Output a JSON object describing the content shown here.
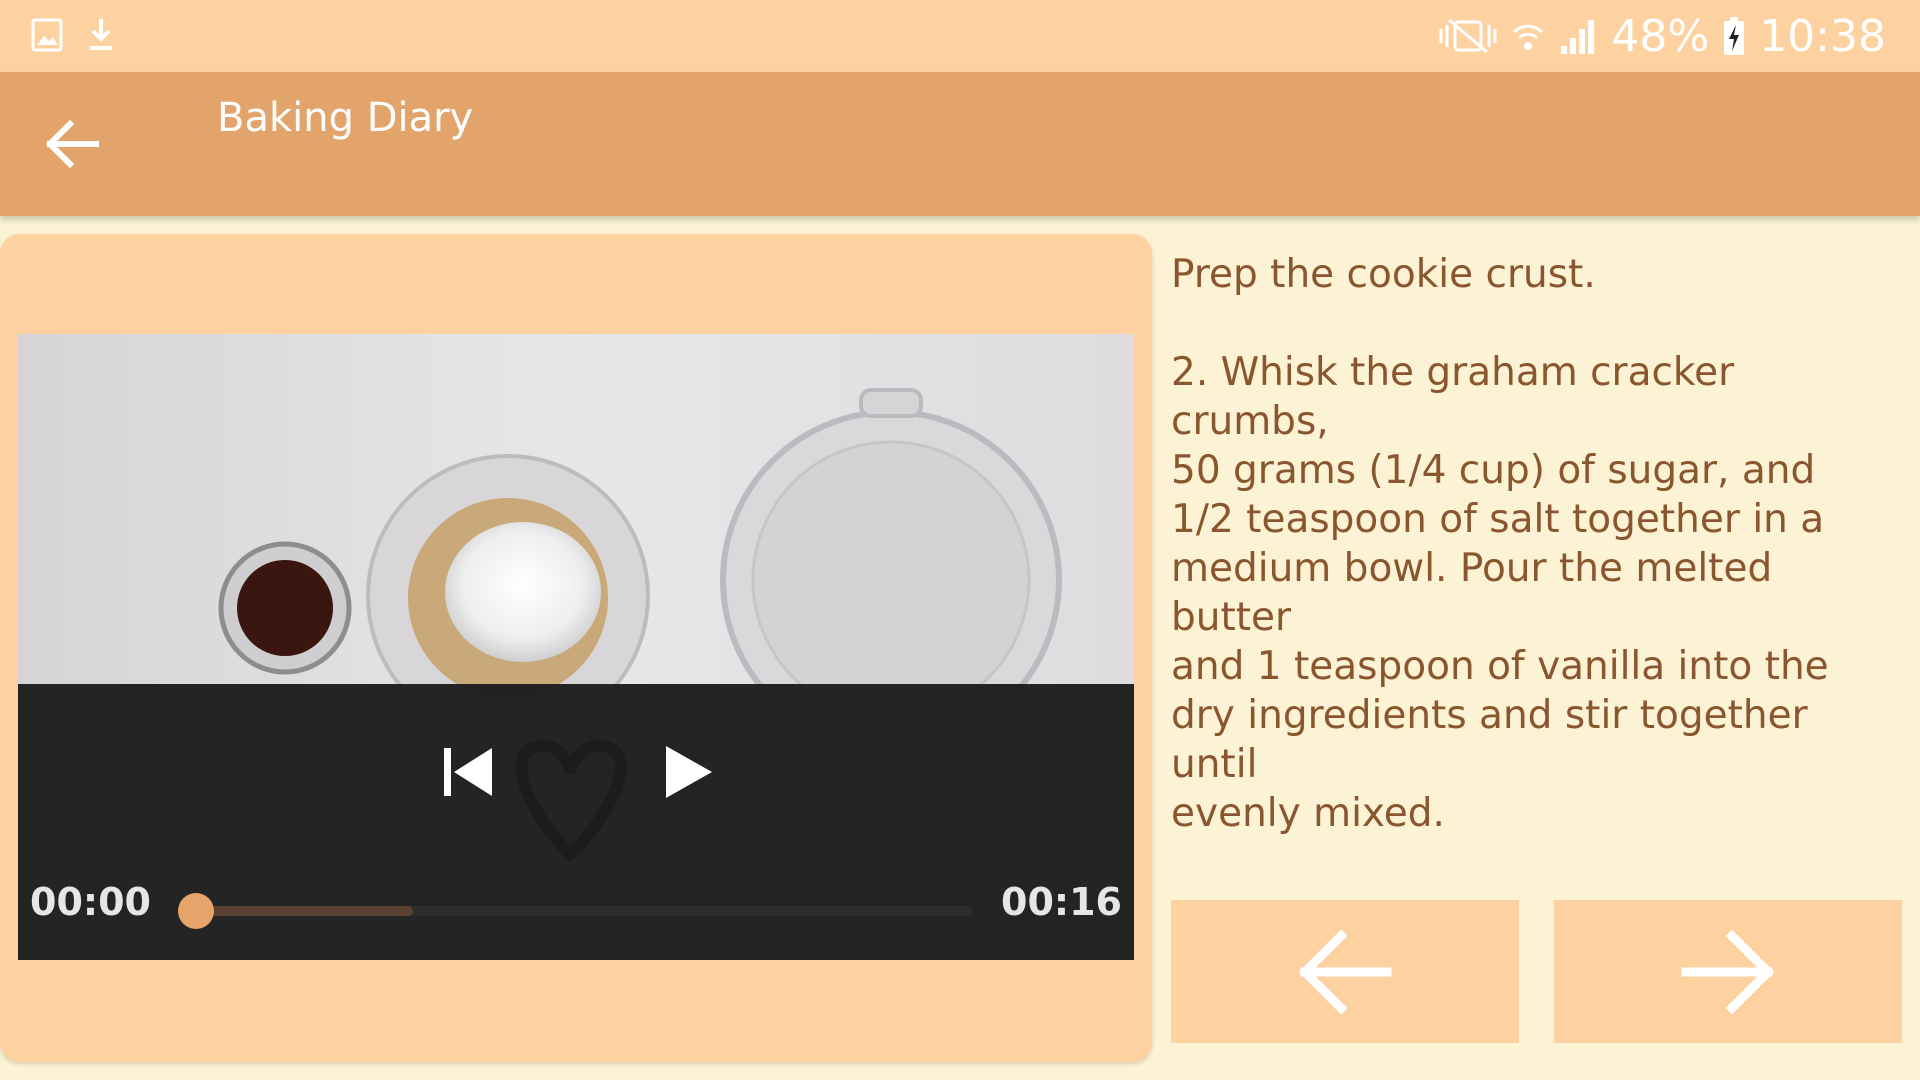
{
  "status_bar": {
    "battery": "48%",
    "time": "10:38",
    "icons": [
      "image-icon",
      "download-icon",
      "vibrate-mute-icon",
      "wifi-icon",
      "signal-icon",
      "battery-charging-icon"
    ]
  },
  "app_bar": {
    "title": "Baking Diary",
    "back_icon": "arrow-left-icon"
  },
  "video": {
    "current_time": "00:00",
    "duration": "00:16",
    "playback_progress": 0,
    "buffered_fraction": 0.28,
    "state": "paused",
    "controls": [
      "skip-previous-icon",
      "play-icon"
    ]
  },
  "step": {
    "title": "Prep the cookie crust.",
    "description": "2. Whisk the graham cracker crumbs,\n50 grams (1/4 cup) of sugar, and\n1/2 teaspoon of salt together in a\nmedium bowl. Pour the melted butter\nand 1 teaspoon of vanilla into the\ndry ingredients and stir together until\nevenly mixed."
  },
  "navigation": {
    "previous_icon": "arrow-left-icon",
    "next_icon": "arrow-right-icon"
  },
  "colors": {
    "status_bar": "#fdd2a0",
    "app_bar": "#e3a46b",
    "background": "#fbf3d3",
    "card": "#fdd2a0",
    "text": "#8a5630",
    "accent": "#e6a46b"
  }
}
